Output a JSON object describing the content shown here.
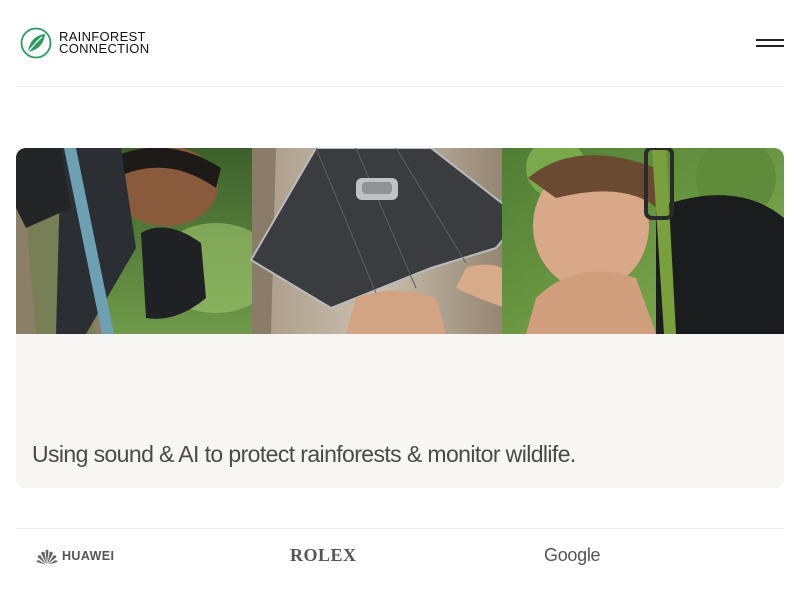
{
  "brand": {
    "name_line1": "RAINFOREST",
    "name_line2": "CONNECTION",
    "logo_color": "#2e9c5e"
  },
  "header": {
    "menu_icon": "hamburger-menu-icon"
  },
  "hero": {
    "image_alt": "Field technicians installing an acoustic monitoring device on a rainforest tree",
    "tagline": "Using sound & AI to protect rainforests & monitor wildlife."
  },
  "partners": [
    {
      "name": "HUAWEI",
      "icon": "huawei-petal-icon"
    },
    {
      "name": "ROLEX"
    },
    {
      "name": "Google"
    }
  ],
  "colors": {
    "accent_green": "#2e9c5e",
    "hero_panel": "#f7f6f4",
    "divider": "#ececec"
  }
}
